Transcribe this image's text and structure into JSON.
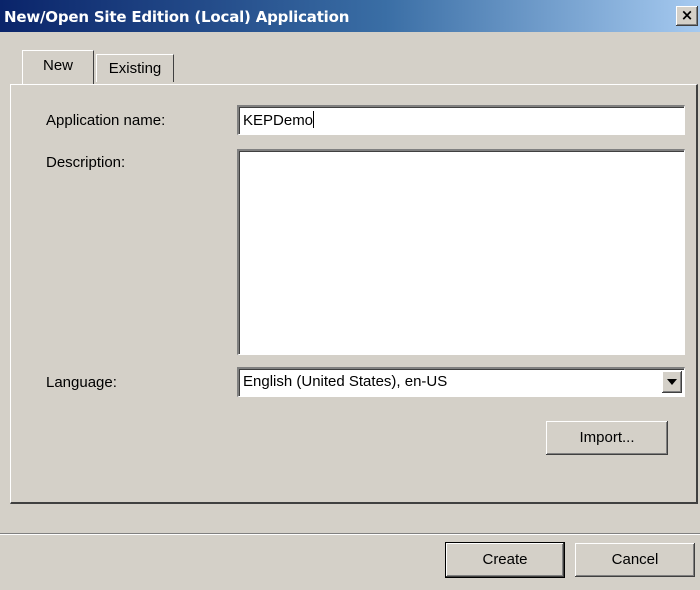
{
  "window": {
    "title": "New/Open Site Edition (Local) Application",
    "close_glyph": "×"
  },
  "tabs": [
    {
      "label": "New",
      "active": true
    },
    {
      "label": "Existing",
      "active": false
    }
  ],
  "form": {
    "app_name_label": "Application name:",
    "app_name_value": "KEPDemo",
    "description_label": "Description:",
    "description_value": "",
    "language_label": "Language:",
    "language_value": "English (United States), en-US"
  },
  "buttons": {
    "import": "Import...",
    "create": "Create",
    "cancel": "Cancel"
  },
  "icons": {
    "close": "close-icon",
    "dropdown": "chevron-down-icon"
  }
}
